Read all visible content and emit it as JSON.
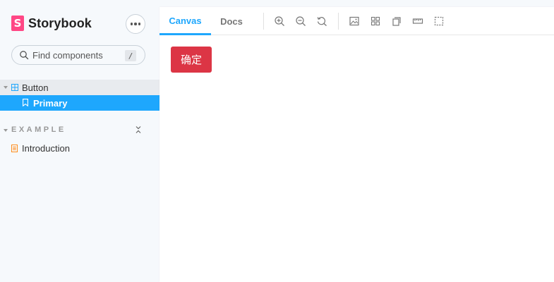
{
  "sidebar": {
    "brand": {
      "logo_letter": "S",
      "name": "Storybook"
    },
    "search": {
      "placeholder": "Find components",
      "shortcut": "/"
    },
    "tree": {
      "component": {
        "label": "Button"
      },
      "story": {
        "label": "Primary"
      }
    },
    "group": {
      "title": "EXAMPLE",
      "items": [
        {
          "label": "Introduction"
        }
      ]
    }
  },
  "toolbar": {
    "tabs": [
      {
        "label": "Canvas",
        "active": true
      },
      {
        "label": "Docs",
        "active": false
      }
    ],
    "tools": [
      "zoom-in-icon",
      "zoom-out-icon",
      "zoom-reset-icon",
      "background-icon",
      "grid-icon",
      "viewport-icon",
      "measure-icon",
      "outline-icon"
    ]
  },
  "preview": {
    "button_label": "确定"
  },
  "colors": {
    "accent": "#1ea7fd",
    "brand": "#ff4785",
    "preview_button": "#dc3545",
    "sidebar_bg": "#f6f9fc"
  }
}
